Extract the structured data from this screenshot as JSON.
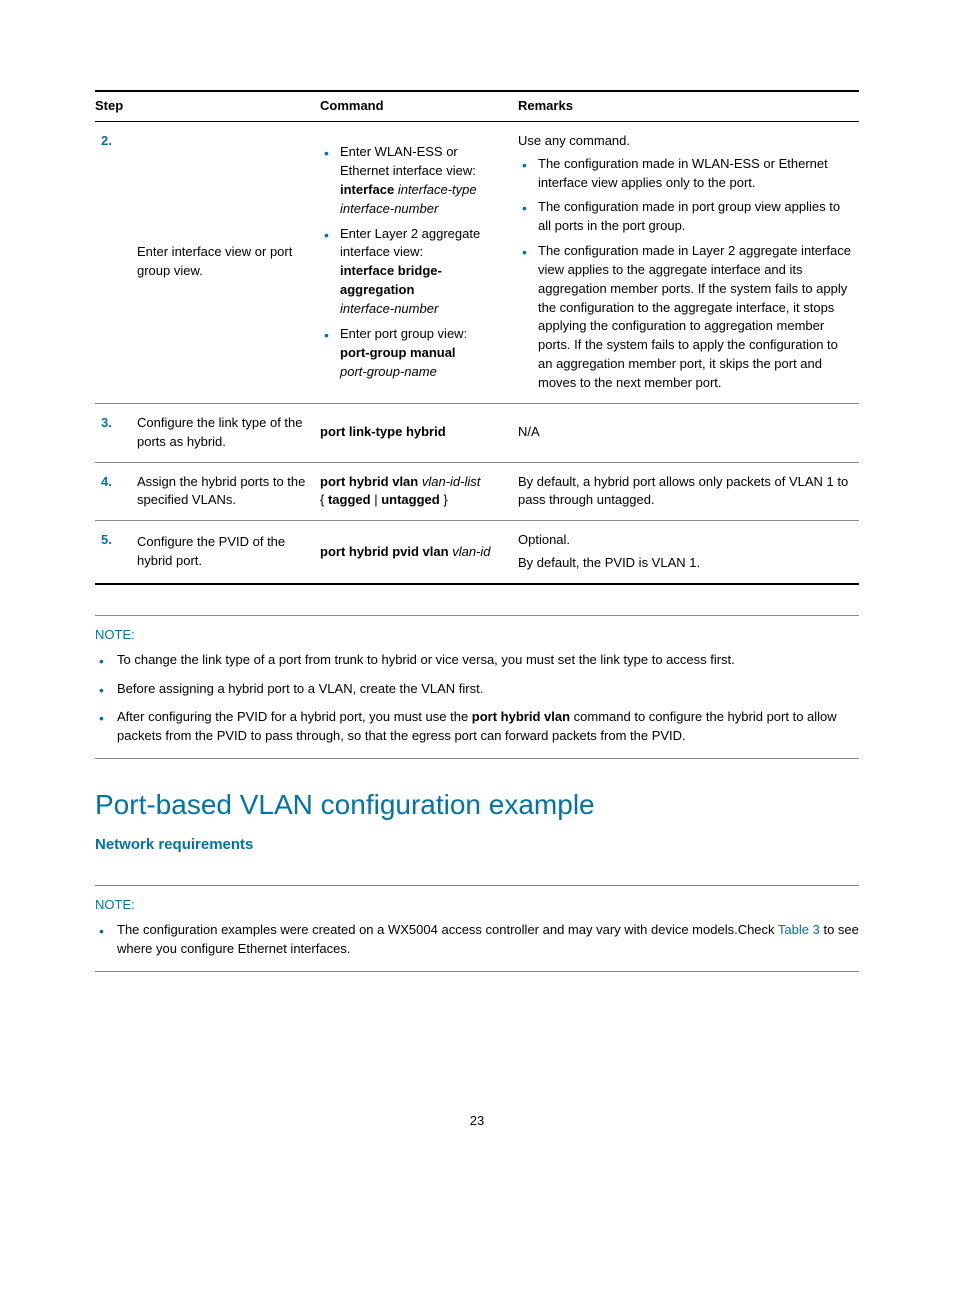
{
  "table": {
    "headers": {
      "step": "Step",
      "command": "Command",
      "remarks": "Remarks"
    },
    "rows": [
      {
        "num": "2.",
        "desc": "Enter interface view or port group view.",
        "cmd_items": [
          {
            "lead": "Enter WLAN-ESS or Ethernet interface view:",
            "bold1": "interface",
            "ital1": "interface-type interface-number"
          },
          {
            "lead": "Enter Layer 2 aggregate interface view:",
            "bold1": "interface bridge-aggregation",
            "ital1": "interface-number"
          },
          {
            "lead": "Enter port group view:",
            "bold1": "port-group manual",
            "ital1": "port-group-name"
          }
        ],
        "remarks_pre": "Use any command.",
        "remarks_items": [
          "The configuration made in WLAN-ESS or Ethernet interface view applies only to the port.",
          "The configuration made in port group view applies to all ports in the port group.",
          "The configuration made in Layer 2 aggregate interface view applies to the aggregate interface and its aggregation member ports. If the system fails to apply the configuration to the aggregate interface, it stops applying the configuration to aggregation member ports. If the system fails to apply the configuration to an aggregation member port, it skips the port and moves to the next member port."
        ]
      },
      {
        "num": "3.",
        "desc": "Configure the link type of the ports as hybrid.",
        "cmd_plain_bold": "port link-type hybrid",
        "remarks_plain": "N/A"
      },
      {
        "num": "4.",
        "desc": "Assign the hybrid ports to the specified VLANs.",
        "cmd4_bold1": "port hybrid vlan",
        "cmd4_ital1": "vlan-id-list",
        "cmd4_brace_open": "{ ",
        "cmd4_bold2": "tagged",
        "cmd4_pipe": " | ",
        "cmd4_bold3": "untagged",
        "cmd4_brace_close": " }",
        "remarks_plain": "By default, a hybrid port allows only packets of VLAN 1 to pass through untagged."
      },
      {
        "num": "5.",
        "desc": "Configure the PVID of the hybrid port.",
        "cmd5_bold": "port hybrid pvid vlan",
        "cmd5_ital": "vlan-id",
        "remarks5_line1": "Optional.",
        "remarks5_line2": "By default, the PVID is VLAN 1."
      }
    ]
  },
  "note1": {
    "label": "NOTE:",
    "items": [
      {
        "text_a": "To change the link type of a port from trunk to hybrid or vice versa, you must set the link type to access first."
      },
      {
        "text_a": "Before assigning a hybrid port to a VLAN, create the VLAN first."
      },
      {
        "text_a": "After configuring the PVID for a hybrid port, you must use the ",
        "bold": "port hybrid vlan",
        "text_b": " command to configure the hybrid port to allow packets from the PVID to pass through, so that the egress port can forward packets from the PVID."
      }
    ]
  },
  "section_title": "Port-based VLAN configuration example",
  "sub_title": "Network requirements",
  "note2": {
    "label": "NOTE:",
    "item_text_a": "The configuration examples were created on a WX5004 access controller and may vary with device models.Check ",
    "item_link": "Table 3",
    "item_text_b": " to see where you configure Ethernet interfaces."
  },
  "page_number": "23"
}
